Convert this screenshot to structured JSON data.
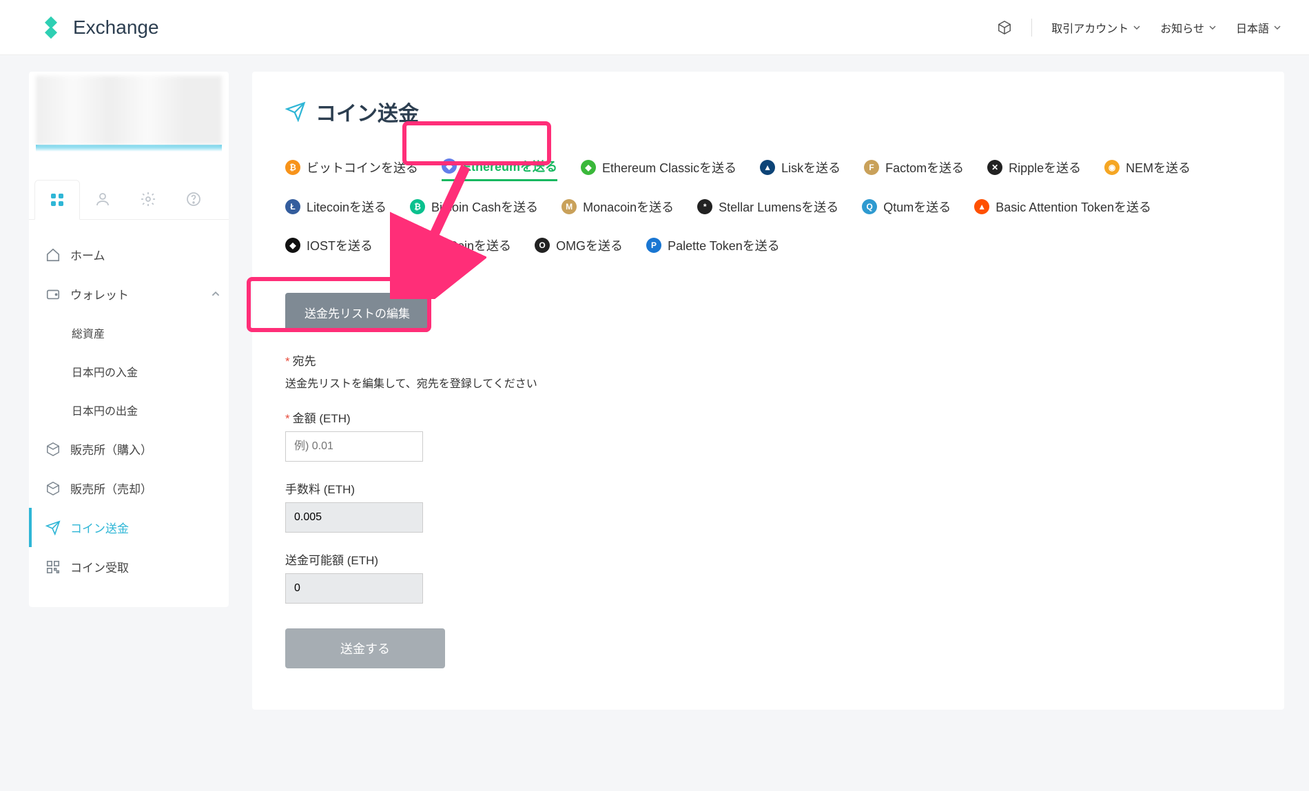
{
  "header": {
    "logo_text": "Exchange",
    "menu": {
      "account": "取引アカウント",
      "notice": "お知らせ",
      "lang": "日本語"
    }
  },
  "sidebar": {
    "tabs": [
      "grid",
      "user",
      "gear",
      "help"
    ],
    "nav": {
      "home": "ホーム",
      "wallet": "ウォレット",
      "total_assets": "総資産",
      "jpy_deposit": "日本円の入金",
      "jpy_withdraw": "日本円の出金",
      "buy": "販売所（購入）",
      "sell": "販売所（売却）",
      "send": "コイン送金",
      "receive": "コイン受取"
    }
  },
  "page": {
    "title": "コイン送金",
    "coins": [
      {
        "id": "btc",
        "label": "ビットコインを送る",
        "bg": "#f7931a",
        "sym": "₿"
      },
      {
        "id": "eth",
        "label": "Ethereumを送る",
        "bg": "#627eea",
        "sym": "◆",
        "active": true
      },
      {
        "id": "etc",
        "label": "Ethereum Classicを送る",
        "bg": "#3ab83a",
        "sym": "◆"
      },
      {
        "id": "lsk",
        "label": "Liskを送る",
        "bg": "#0d4477",
        "sym": "▲"
      },
      {
        "id": "fct",
        "label": "Factomを送る",
        "bg": "#c9a15a",
        "sym": "F"
      },
      {
        "id": "xrp",
        "label": "Rippleを送る",
        "bg": "#222",
        "sym": "✕"
      },
      {
        "id": "xem",
        "label": "NEMを送る",
        "bg": "#f5a623",
        "sym": "◉"
      },
      {
        "id": "ltc",
        "label": "Litecoinを送る",
        "bg": "#345d9d",
        "sym": "Ł"
      },
      {
        "id": "bch",
        "label": "Bitcoin Cashを送る",
        "bg": "#0ac18e",
        "sym": "₿"
      },
      {
        "id": "mona",
        "label": "Monacoinを送る",
        "bg": "#c9a15a",
        "sym": "M"
      },
      {
        "id": "xlm",
        "label": "Stellar Lumensを送る",
        "bg": "#222",
        "sym": "*"
      },
      {
        "id": "qtum",
        "label": "Qtumを送る",
        "bg": "#2e9ad0",
        "sym": "Q"
      },
      {
        "id": "bat",
        "label": "Basic Attention Tokenを送る",
        "bg": "#ff5000",
        "sym": "▲"
      },
      {
        "id": "iost",
        "label": "IOSTを送る",
        "bg": "#111",
        "sym": "◆"
      },
      {
        "id": "enj",
        "label": "Enjin Coinを送る",
        "bg": "#624dbf",
        "sym": "E"
      },
      {
        "id": "omg",
        "label": "OMGを送る",
        "bg": "#222",
        "sym": "O"
      },
      {
        "id": "plt",
        "label": "Palette Tokenを送る",
        "bg": "#1976d2",
        "sym": "P"
      }
    ],
    "edit_list_btn": "送金先リストの編集",
    "form": {
      "dest_label": "宛先",
      "dest_hint": "送金先リストを編集して、宛先を登録してください",
      "amount_label": "金額 (ETH)",
      "amount_placeholder": "例) 0.01",
      "fee_label": "手数料 (ETH)",
      "fee_value": "0.005",
      "available_label": "送金可能額 (ETH)",
      "available_value": "0",
      "submit": "送金する"
    }
  }
}
